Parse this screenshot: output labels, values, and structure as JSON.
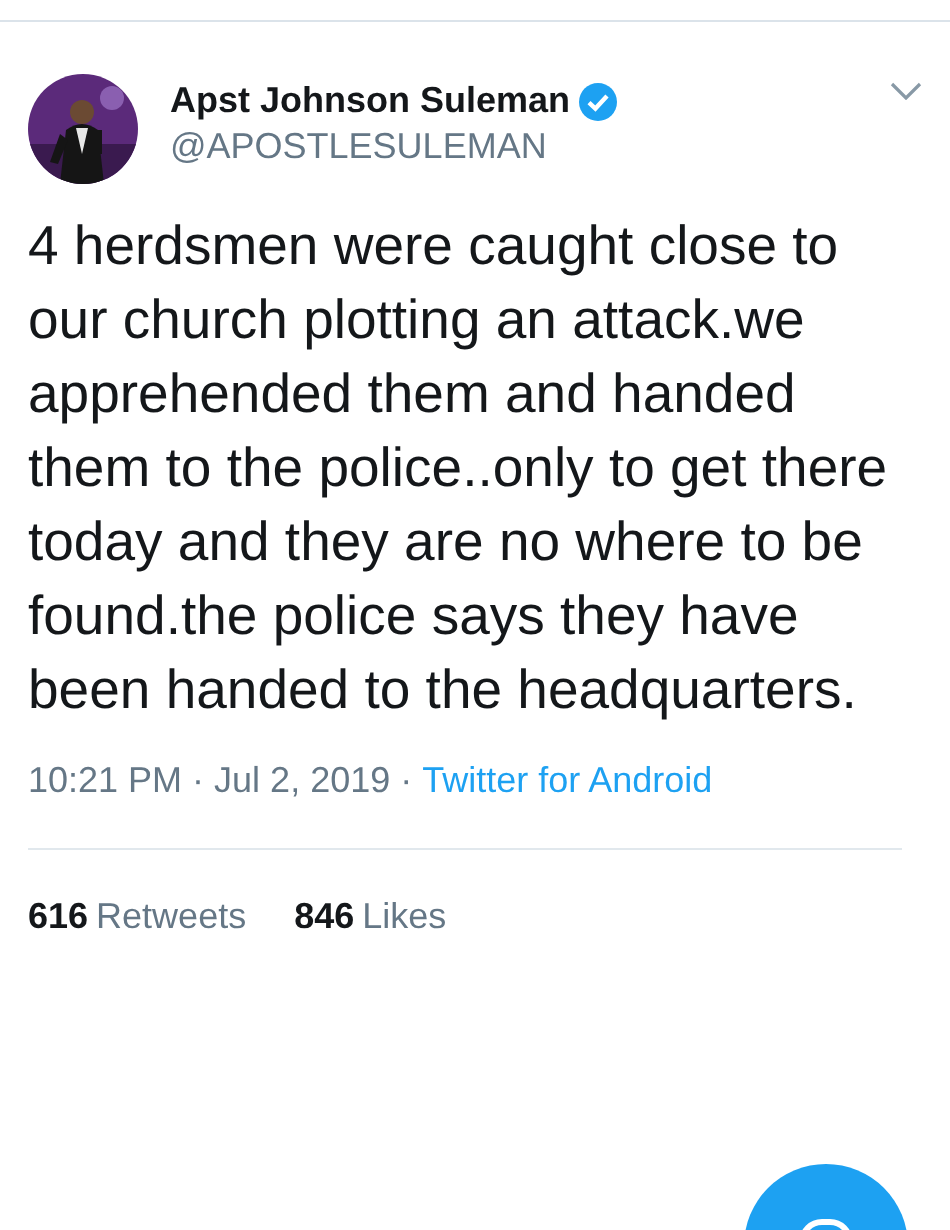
{
  "tweet": {
    "author": {
      "name": "Apst Johnson Suleman",
      "verified": true,
      "handle": "@APOSTLESULEMAN"
    },
    "text": "4 herdsmen were caught close to our church plotting an attack.we apprehended them and handed them to the police..only to get there today and they are no where to be found.the police says they have been handed to the headquarters.",
    "meta": [
      {
        "kind": "plain",
        "text": "10:21 PM"
      },
      {
        "kind": "separator",
        "text": "·"
      },
      {
        "kind": "plain",
        "text": "Jul 2, 2019"
      },
      {
        "kind": "separator",
        "text": "·"
      },
      {
        "kind": "link",
        "text": "Twitter for Android"
      }
    ],
    "stats": [
      {
        "count": "616",
        "label": "Retweets"
      },
      {
        "count": "846",
        "label": "Likes"
      }
    ]
  }
}
